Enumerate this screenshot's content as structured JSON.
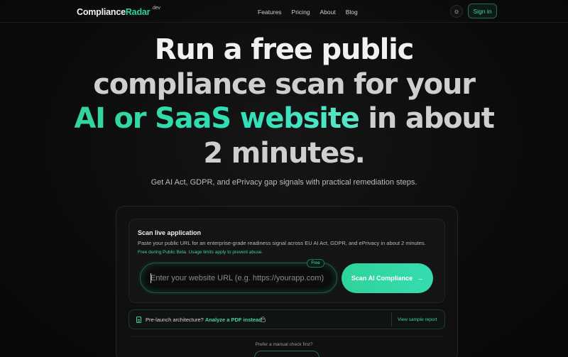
{
  "nav": {
    "logo_main": "Compliance",
    "logo_accent": "Radar",
    "logo_suffix": ".dev",
    "links": [
      "Features",
      "Pricing",
      "About",
      "Blog"
    ],
    "theme_icon": "sun-icon",
    "signin_label": "Sign in"
  },
  "hero": {
    "line1": "Run a free public",
    "line2": "compliance scan for your",
    "line3_highlight": "AI or SaaS website",
    "line3_rest": " in about",
    "line4": "2 minutes.",
    "subtitle": "Get AI Act, GDPR, and ePrivacy gap signals with practical remediation steps."
  },
  "scan": {
    "title": "Scan live application",
    "description": "Paste your public URL for an enterprise-grade readiness signal across EU AI Act, GDPR, and ePrivacy in about 2 minutes.",
    "note": "Free during Public Beta. Usage limits apply to prevent abuse.",
    "input_placeholder": "Enter your website URL (e.g. https://yourapp.com)",
    "free_badge": "Free",
    "button_label": "Scan AI Compliance",
    "button_icon": "arrow-right-icon"
  },
  "prelaunch": {
    "text": "Pre-launch architecture?",
    "link": "Analyze a PDF instead",
    "lock_icon": "lock-icon",
    "sample_link": "View sample report"
  },
  "manual": {
    "text": "Prefer a manual check first?"
  },
  "colors": {
    "accent": "#2fd39a",
    "background": "#0b0b0b"
  }
}
